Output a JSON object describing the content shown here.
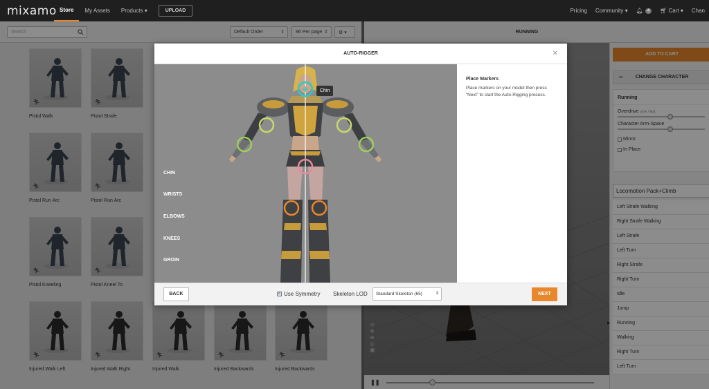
{
  "nav": {
    "logo": "mixamo",
    "store": "Store",
    "my_assets": "My Assets",
    "products": "Products ▾",
    "upload": "UPLOAD",
    "pricing": "Pricing",
    "community": "Community ▾",
    "notif_count": "4",
    "cart": "Cart ▾",
    "user": "Chan"
  },
  "toolbar": {
    "search_placeholder": "Search",
    "order": "Default Order",
    "per_page": "96 Per page",
    "settings": "⚙ ▾"
  },
  "viewer": {
    "title": "RUNNING"
  },
  "grid": {
    "cards": [
      "Pistol Walk",
      "Pistol Strafe",
      "Pistol Run Arc",
      "Pistol Run Arc",
      "Pistol Kneeling",
      "Pistol Kneel To",
      "Injured Walk Left",
      "Injured Walk Right",
      "Injured Walk",
      "Injured Backwards",
      "Injured Backwards"
    ]
  },
  "right_panel": {
    "add_to_cart": "ADD TO CART",
    "change_character": "CHANGE CHARACTER",
    "params_title": "Running",
    "overdrive": "Overdrive",
    "overdrive_hint": "slow / fast",
    "arm_space": "Character Arm-Space",
    "mirror": "Mirror",
    "in_place": "In Place",
    "pack": "Locomotion Pack+Climb",
    "pack_items": [
      "Left Strafe Walking",
      "Right Strafe Walking",
      "Left Strafe",
      "Left Turn",
      "Right Strafe",
      "Right Turn",
      "Idle",
      "Jump",
      "Running",
      "Walking",
      "Right Turn",
      "Left Turn"
    ],
    "selected_item": "Running"
  },
  "modal": {
    "title": "AUTO-RIGGER",
    "close": "✕",
    "marker_labels": [
      "CHIN",
      "WRISTS",
      "ELBOWS",
      "KNEES",
      "GROIN"
    ],
    "tooltip": "Chin",
    "instructions_title": "Place Markers",
    "instructions_text": "Place markers on your model then press “Next” to start the Auto-Rigging process.",
    "back": "BACK",
    "use_symmetry": "Use Symmetry",
    "skeleton_lod_label": "Skeleton LOD",
    "skeleton_lod_value": "Standard Skeleton (65)",
    "next": "NEXT"
  },
  "colors": {
    "accent": "#e8872c",
    "marker_chin": "#2ec8c8",
    "marker_elbow": "#c8d86a",
    "marker_wrist": "#9ccf5a",
    "marker_groin": "#e78a9a",
    "marker_knee": "#e8872c"
  }
}
